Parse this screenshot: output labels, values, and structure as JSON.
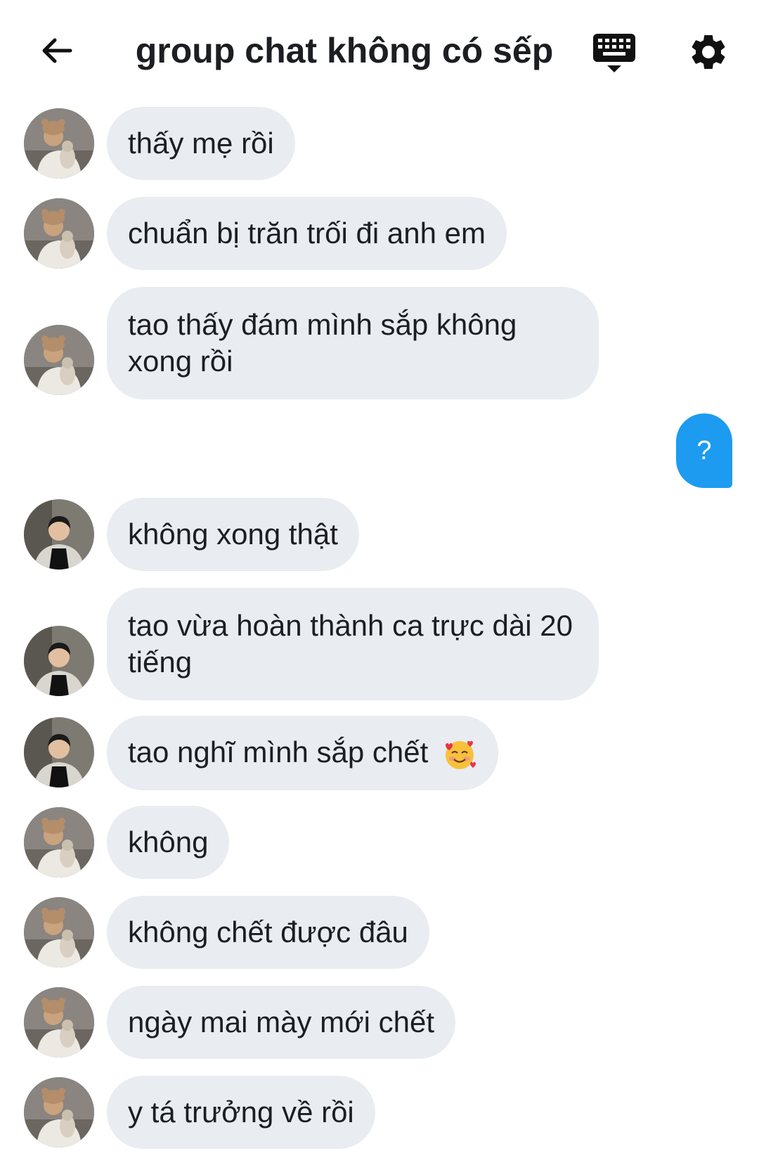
{
  "header": {
    "title": "group chat không có sếp",
    "back_icon": "arrow-left-icon",
    "keyboard_icon": "keyboard-icon",
    "settings_icon": "gear-icon"
  },
  "messages": [
    {
      "sender": "a",
      "text": "thấy mẹ rồi"
    },
    {
      "sender": "a",
      "text": "chuẩn bị trăn trối đi anh em"
    },
    {
      "sender": "a",
      "text": "tao thấy đám mình sắp không xong rồi"
    },
    {
      "sender": "me",
      "text": "?"
    },
    {
      "sender": "b",
      "text": "không xong thật"
    },
    {
      "sender": "b",
      "text": "tao vừa hoàn thành ca trực dài 20 tiếng"
    },
    {
      "sender": "b",
      "text": "tao nghĩ mình sắp chết",
      "emoji": "smiling-face-with-hearts"
    },
    {
      "sender": "a",
      "text": "không"
    },
    {
      "sender": "a",
      "text": "không chết được đâu"
    },
    {
      "sender": "a",
      "text": "ngày mai mày mới chết"
    },
    {
      "sender": "a",
      "text": "y tá trưởng về rồi"
    }
  ],
  "colors": {
    "incoming_bubble": "#e9ecf0",
    "outgoing_bubble": "#1d9bf0"
  }
}
